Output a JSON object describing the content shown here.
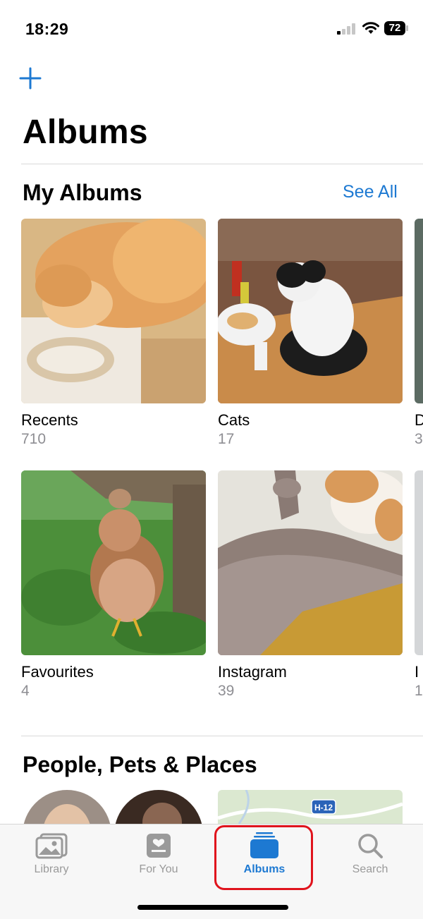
{
  "status": {
    "time": "18:29",
    "battery": "72"
  },
  "page": {
    "title": "Albums"
  },
  "my_albums": {
    "title": "My Albums",
    "see_all": "See All",
    "albums": [
      {
        "name": "Recents",
        "count": "710"
      },
      {
        "name": "Cats",
        "count": "17"
      },
      {
        "name": "D",
        "count": "3"
      },
      {
        "name": "Favourites",
        "count": "4"
      },
      {
        "name": "Instagram",
        "count": "39"
      },
      {
        "name": "I",
        "count": "1"
      }
    ]
  },
  "people_section": {
    "title": "People, Pets & Places",
    "map_label": "H-12"
  },
  "tabs": [
    {
      "label": "Library",
      "icon": "library-icon"
    },
    {
      "label": "For You",
      "icon": "for-you-icon"
    },
    {
      "label": "Albums",
      "icon": "albums-icon",
      "active": true
    },
    {
      "label": "Search",
      "icon": "search-icon"
    }
  ],
  "colors": {
    "accent": "#1d79d2",
    "highlight": "#e0141d",
    "secondary_text": "#8e8e93"
  }
}
